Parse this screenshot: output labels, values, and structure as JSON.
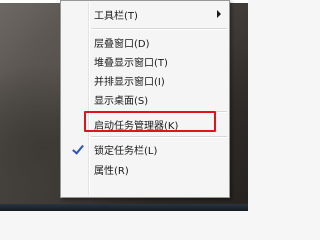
{
  "context_menu": {
    "items": [
      {
        "label": "工具栏(T)",
        "has_submenu": true,
        "checked": false
      },
      {
        "label": "层叠窗口(D)",
        "has_submenu": false,
        "checked": false
      },
      {
        "label": "堆叠显示窗口(T)",
        "has_submenu": false,
        "checked": false
      },
      {
        "label": "并排显示窗口(I)",
        "has_submenu": false,
        "checked": false
      },
      {
        "label": "显示桌面(S)",
        "has_submenu": false,
        "checked": false
      },
      {
        "label": "启动任务管理器(K)",
        "has_submenu": false,
        "checked": false,
        "highlighted": true
      },
      {
        "label": "锁定任务栏(L)",
        "has_submenu": false,
        "checked": true
      },
      {
        "label": "属性(R)",
        "has_submenu": false,
        "checked": false
      }
    ]
  },
  "colors": {
    "highlight_border": "#e0151b",
    "checkmark": "#2a52be",
    "menu_background": "#f5f5f5"
  },
  "icons": {
    "submenu": "chevron-right-icon",
    "checked": "checkmark-icon"
  }
}
